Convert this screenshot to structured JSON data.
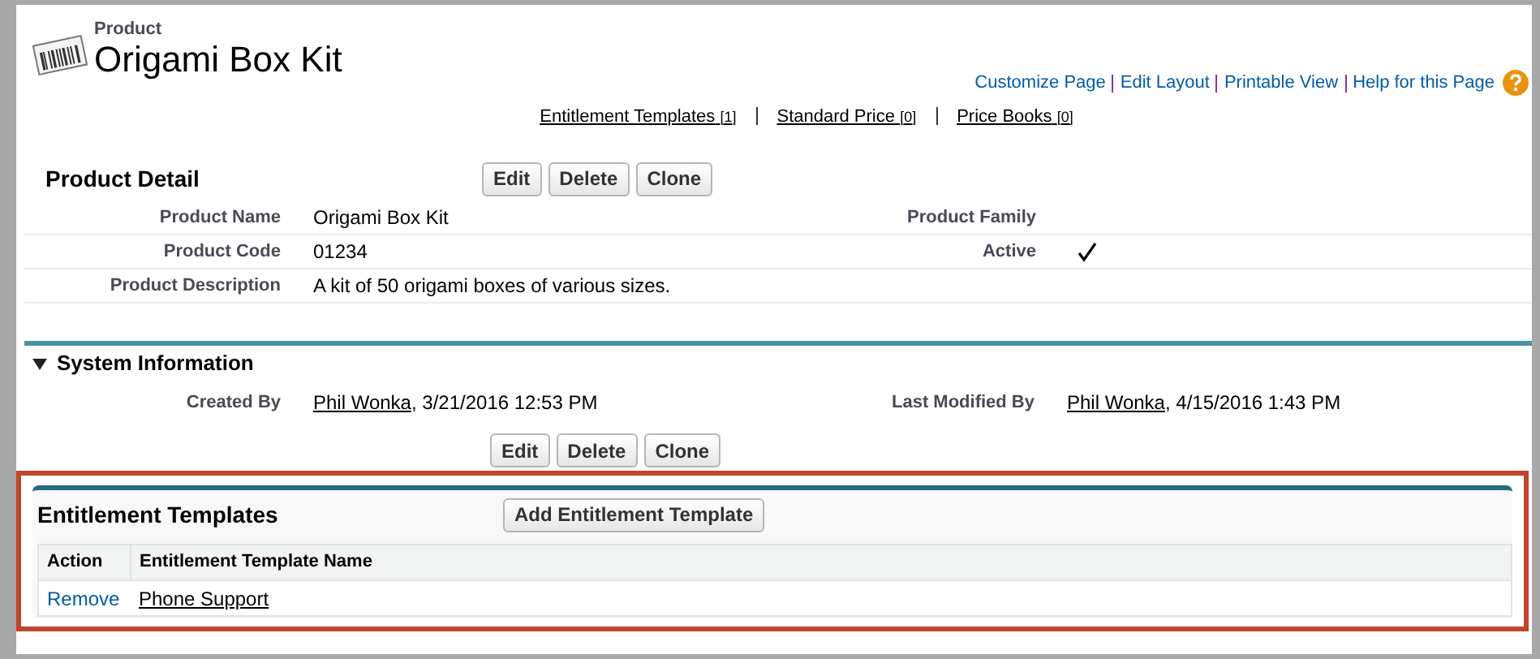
{
  "header": {
    "object_type": "Product",
    "title": "Origami Box Kit"
  },
  "page_links": [
    "Customize Page",
    "Edit Layout",
    "Printable View",
    "Help for this Page"
  ],
  "related_links": [
    {
      "label": "Entitlement Templates",
      "count": "[1]"
    },
    {
      "label": "Standard Price",
      "count": "[0]"
    },
    {
      "label": "Price Books",
      "count": "[0]"
    }
  ],
  "detail": {
    "title": "Product Detail",
    "buttons": [
      "Edit",
      "Delete",
      "Clone"
    ],
    "fields_left": [
      {
        "label": "Product Name",
        "value": "Origami Box Kit"
      },
      {
        "label": "Product Code",
        "value": "01234"
      },
      {
        "label": "Product Description",
        "value": "A kit of 50 origami boxes of various sizes."
      }
    ],
    "fields_right": [
      {
        "label": "Product Family",
        "kind": "text"
      },
      {
        "label": "Active",
        "kind": "checkbox",
        "checked": true
      }
    ]
  },
  "system_info": {
    "title": "System Information",
    "expanded": true,
    "fields": [
      {
        "label": "Created By",
        "user": "Phil Wonka",
        "date": ", 3/21/2016 12:53 PM"
      },
      {
        "label": "Last Modified By",
        "user": "Phil Wonka",
        "date": ", 4/15/2016 1:43 PM"
      }
    ],
    "buttons": [
      "Edit",
      "Delete",
      "Clone"
    ]
  },
  "entitlement_templates": {
    "title": "Entitlement Templates",
    "button": "Add Entitlement Template",
    "columns": [
      "Action",
      "Entitlement Template Name"
    ],
    "rows": [
      {
        "action": "Remove",
        "name": "Phone Support"
      }
    ]
  }
}
